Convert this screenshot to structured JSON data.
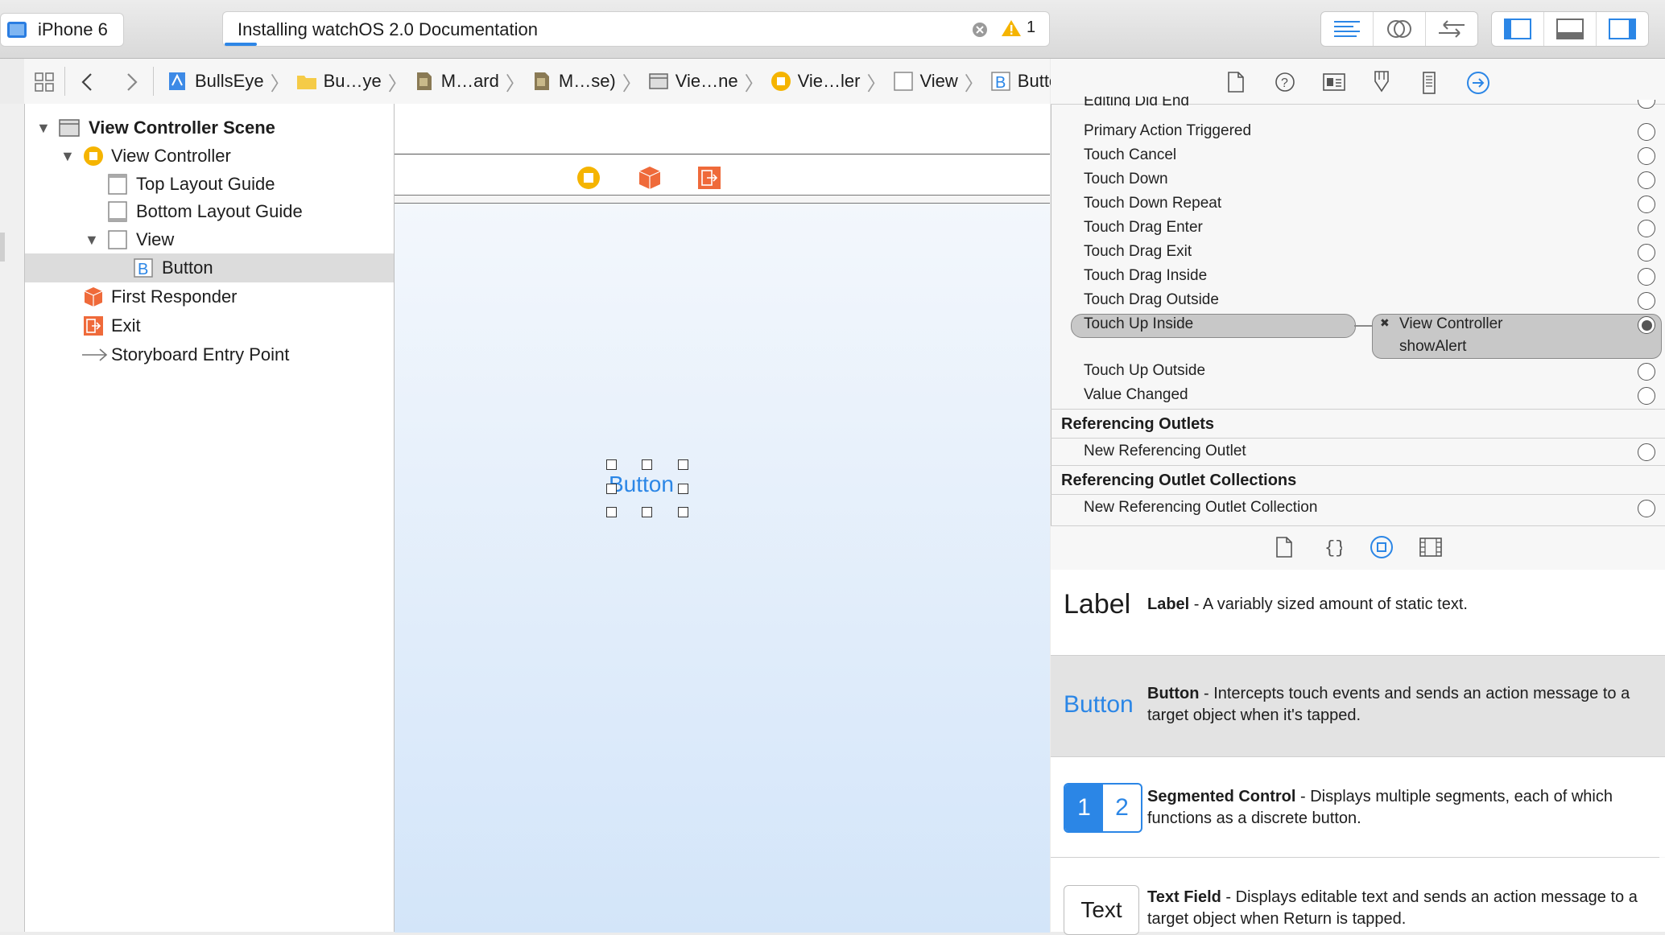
{
  "toolbar": {
    "scheme_device": "iPhone 6",
    "activity_text": "Installing watchOS 2.0 Documentation",
    "warning_count": "1"
  },
  "jumpbar": {
    "crumbs": [
      "BullsEye",
      "Bu…ye",
      "M…ard",
      "M…se)",
      "Vie…ne",
      "Vie…ler",
      "View",
      "Button"
    ]
  },
  "outline": {
    "scene": "View Controller Scene",
    "view_controller": "View Controller",
    "top_layout_guide": "Top Layout Guide",
    "bottom_layout_guide": "Bottom Layout Guide",
    "view": "View",
    "button": "Button",
    "first_responder": "First Responder",
    "exit": "Exit",
    "entry_point": "Storyboard Entry Point"
  },
  "canvas": {
    "button_label": "Button"
  },
  "inspector": {
    "events": {
      "editing_did_end": "Editing Did End",
      "primary_action": "Primary Action Triggered",
      "touch_cancel": "Touch Cancel",
      "touch_down": "Touch Down",
      "touch_down_repeat": "Touch Down Repeat",
      "touch_drag_enter": "Touch Drag Enter",
      "touch_drag_exit": "Touch Drag Exit",
      "touch_drag_inside": "Touch Drag Inside",
      "touch_drag_outside": "Touch Drag Outside",
      "touch_up_inside": "Touch Up Inside",
      "touch_up_outside": "Touch Up Outside",
      "value_changed": "Value Changed"
    },
    "connection": {
      "target": "View Controller",
      "action": "showAlert"
    },
    "referencing_outlets": "Referencing Outlets",
    "new_referencing_outlet": "New Referencing Outlet",
    "referencing_outlet_collections": "Referencing Outlet Collections",
    "new_referencing_outlet_collection": "New Referencing Outlet Collection"
  },
  "library": {
    "label": {
      "icon_text": "Label",
      "title": "Label",
      "desc": " - A variably sized amount of static text."
    },
    "button": {
      "icon_text": "Button",
      "title": "Button",
      "desc": " - Intercepts touch events and sends an action message to a target object when it's tapped."
    },
    "segmented": {
      "seg1": "1",
      "seg2": "2",
      "title": "Segmented Control",
      "desc": " - Displays multiple segments, each of which functions as a discrete button."
    },
    "textfield": {
      "icon_text": "Text",
      "title": "Text Field",
      "desc": " - Displays editable text and sends an action message to a target object when Return is tapped."
    }
  },
  "colors": {
    "accent": "#2b86e6",
    "warning": "#f5b400",
    "object_orange": "#ef6a3a"
  }
}
